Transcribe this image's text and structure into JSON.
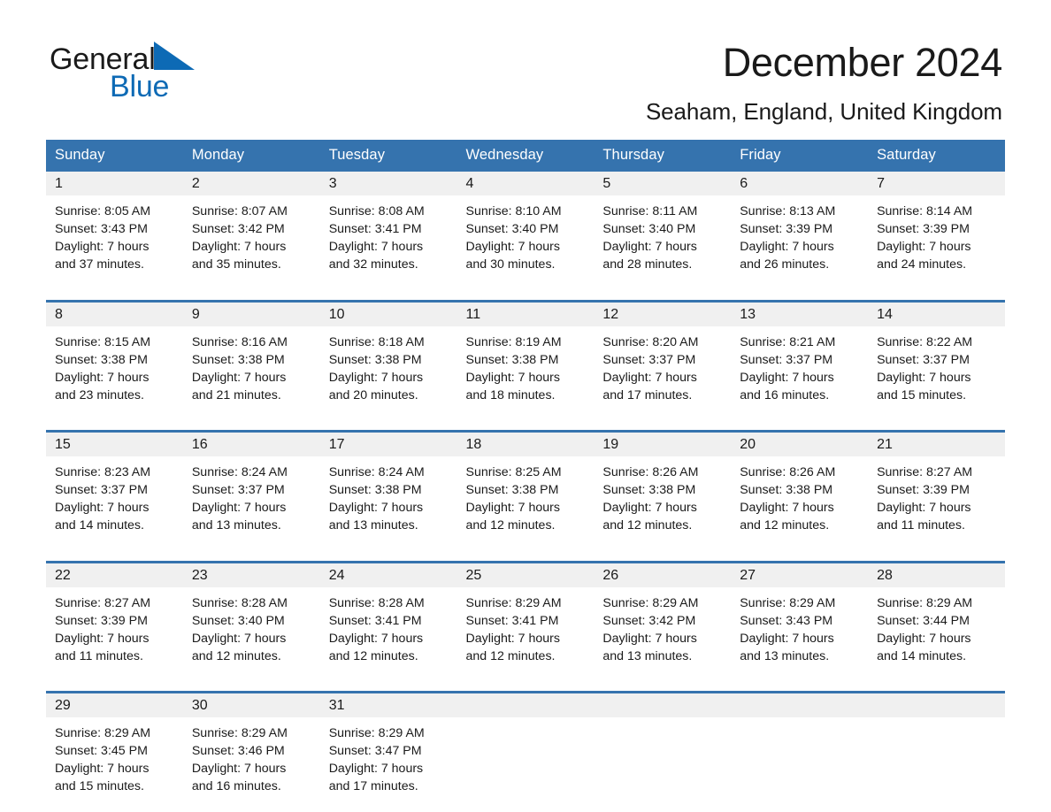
{
  "brand": {
    "word1": "General",
    "word2": "Blue",
    "triangle_color": "#0d6ab5",
    "text_color": "#1a1a1a",
    "icon": "triangle-logo-icon"
  },
  "header": {
    "title": "December 2024",
    "subtitle": "Seaham, England, United Kingdom"
  },
  "theme": {
    "header_blue": "#3573ae",
    "daynum_gray": "#f0f0f0",
    "text": "#1a1a1a",
    "white": "#ffffff"
  },
  "weekday_headers": [
    "Sunday",
    "Monday",
    "Tuesday",
    "Wednesday",
    "Thursday",
    "Friday",
    "Saturday"
  ],
  "weeks": [
    [
      {
        "day": "1",
        "sunrise": "Sunrise: 8:05 AM",
        "sunset": "Sunset: 3:43 PM",
        "daylight1": "Daylight: 7 hours",
        "daylight2": "and 37 minutes."
      },
      {
        "day": "2",
        "sunrise": "Sunrise: 8:07 AM",
        "sunset": "Sunset: 3:42 PM",
        "daylight1": "Daylight: 7 hours",
        "daylight2": "and 35 minutes."
      },
      {
        "day": "3",
        "sunrise": "Sunrise: 8:08 AM",
        "sunset": "Sunset: 3:41 PM",
        "daylight1": "Daylight: 7 hours",
        "daylight2": "and 32 minutes."
      },
      {
        "day": "4",
        "sunrise": "Sunrise: 8:10 AM",
        "sunset": "Sunset: 3:40 PM",
        "daylight1": "Daylight: 7 hours",
        "daylight2": "and 30 minutes."
      },
      {
        "day": "5",
        "sunrise": "Sunrise: 8:11 AM",
        "sunset": "Sunset: 3:40 PM",
        "daylight1": "Daylight: 7 hours",
        "daylight2": "and 28 minutes."
      },
      {
        "day": "6",
        "sunrise": "Sunrise: 8:13 AM",
        "sunset": "Sunset: 3:39 PM",
        "daylight1": "Daylight: 7 hours",
        "daylight2": "and 26 minutes."
      },
      {
        "day": "7",
        "sunrise": "Sunrise: 8:14 AM",
        "sunset": "Sunset: 3:39 PM",
        "daylight1": "Daylight: 7 hours",
        "daylight2": "and 24 minutes."
      }
    ],
    [
      {
        "day": "8",
        "sunrise": "Sunrise: 8:15 AM",
        "sunset": "Sunset: 3:38 PM",
        "daylight1": "Daylight: 7 hours",
        "daylight2": "and 23 minutes."
      },
      {
        "day": "9",
        "sunrise": "Sunrise: 8:16 AM",
        "sunset": "Sunset: 3:38 PM",
        "daylight1": "Daylight: 7 hours",
        "daylight2": "and 21 minutes."
      },
      {
        "day": "10",
        "sunrise": "Sunrise: 8:18 AM",
        "sunset": "Sunset: 3:38 PM",
        "daylight1": "Daylight: 7 hours",
        "daylight2": "and 20 minutes."
      },
      {
        "day": "11",
        "sunrise": "Sunrise: 8:19 AM",
        "sunset": "Sunset: 3:38 PM",
        "daylight1": "Daylight: 7 hours",
        "daylight2": "and 18 minutes."
      },
      {
        "day": "12",
        "sunrise": "Sunrise: 8:20 AM",
        "sunset": "Sunset: 3:37 PM",
        "daylight1": "Daylight: 7 hours",
        "daylight2": "and 17 minutes."
      },
      {
        "day": "13",
        "sunrise": "Sunrise: 8:21 AM",
        "sunset": "Sunset: 3:37 PM",
        "daylight1": "Daylight: 7 hours",
        "daylight2": "and 16 minutes."
      },
      {
        "day": "14",
        "sunrise": "Sunrise: 8:22 AM",
        "sunset": "Sunset: 3:37 PM",
        "daylight1": "Daylight: 7 hours",
        "daylight2": "and 15 minutes."
      }
    ],
    [
      {
        "day": "15",
        "sunrise": "Sunrise: 8:23 AM",
        "sunset": "Sunset: 3:37 PM",
        "daylight1": "Daylight: 7 hours",
        "daylight2": "and 14 minutes."
      },
      {
        "day": "16",
        "sunrise": "Sunrise: 8:24 AM",
        "sunset": "Sunset: 3:37 PM",
        "daylight1": "Daylight: 7 hours",
        "daylight2": "and 13 minutes."
      },
      {
        "day": "17",
        "sunrise": "Sunrise: 8:24 AM",
        "sunset": "Sunset: 3:38 PM",
        "daylight1": "Daylight: 7 hours",
        "daylight2": "and 13 minutes."
      },
      {
        "day": "18",
        "sunrise": "Sunrise: 8:25 AM",
        "sunset": "Sunset: 3:38 PM",
        "daylight1": "Daylight: 7 hours",
        "daylight2": "and 12 minutes."
      },
      {
        "day": "19",
        "sunrise": "Sunrise: 8:26 AM",
        "sunset": "Sunset: 3:38 PM",
        "daylight1": "Daylight: 7 hours",
        "daylight2": "and 12 minutes."
      },
      {
        "day": "20",
        "sunrise": "Sunrise: 8:26 AM",
        "sunset": "Sunset: 3:38 PM",
        "daylight1": "Daylight: 7 hours",
        "daylight2": "and 12 minutes."
      },
      {
        "day": "21",
        "sunrise": "Sunrise: 8:27 AM",
        "sunset": "Sunset: 3:39 PM",
        "daylight1": "Daylight: 7 hours",
        "daylight2": "and 11 minutes."
      }
    ],
    [
      {
        "day": "22",
        "sunrise": "Sunrise: 8:27 AM",
        "sunset": "Sunset: 3:39 PM",
        "daylight1": "Daylight: 7 hours",
        "daylight2": "and 11 minutes."
      },
      {
        "day": "23",
        "sunrise": "Sunrise: 8:28 AM",
        "sunset": "Sunset: 3:40 PM",
        "daylight1": "Daylight: 7 hours",
        "daylight2": "and 12 minutes."
      },
      {
        "day": "24",
        "sunrise": "Sunrise: 8:28 AM",
        "sunset": "Sunset: 3:41 PM",
        "daylight1": "Daylight: 7 hours",
        "daylight2": "and 12 minutes."
      },
      {
        "day": "25",
        "sunrise": "Sunrise: 8:29 AM",
        "sunset": "Sunset: 3:41 PM",
        "daylight1": "Daylight: 7 hours",
        "daylight2": "and 12 minutes."
      },
      {
        "day": "26",
        "sunrise": "Sunrise: 8:29 AM",
        "sunset": "Sunset: 3:42 PM",
        "daylight1": "Daylight: 7 hours",
        "daylight2": "and 13 minutes."
      },
      {
        "day": "27",
        "sunrise": "Sunrise: 8:29 AM",
        "sunset": "Sunset: 3:43 PM",
        "daylight1": "Daylight: 7 hours",
        "daylight2": "and 13 minutes."
      },
      {
        "day": "28",
        "sunrise": "Sunrise: 8:29 AM",
        "sunset": "Sunset: 3:44 PM",
        "daylight1": "Daylight: 7 hours",
        "daylight2": "and 14 minutes."
      }
    ],
    [
      {
        "day": "29",
        "sunrise": "Sunrise: 8:29 AM",
        "sunset": "Sunset: 3:45 PM",
        "daylight1": "Daylight: 7 hours",
        "daylight2": "and 15 minutes."
      },
      {
        "day": "30",
        "sunrise": "Sunrise: 8:29 AM",
        "sunset": "Sunset: 3:46 PM",
        "daylight1": "Daylight: 7 hours",
        "daylight2": "and 16 minutes."
      },
      {
        "day": "31",
        "sunrise": "Sunrise: 8:29 AM",
        "sunset": "Sunset: 3:47 PM",
        "daylight1": "Daylight: 7 hours",
        "daylight2": "and 17 minutes."
      },
      {
        "day": "",
        "sunrise": "",
        "sunset": "",
        "daylight1": "",
        "daylight2": ""
      },
      {
        "day": "",
        "sunrise": "",
        "sunset": "",
        "daylight1": "",
        "daylight2": ""
      },
      {
        "day": "",
        "sunrise": "",
        "sunset": "",
        "daylight1": "",
        "daylight2": ""
      },
      {
        "day": "",
        "sunrise": "",
        "sunset": "",
        "daylight1": "",
        "daylight2": ""
      }
    ]
  ]
}
